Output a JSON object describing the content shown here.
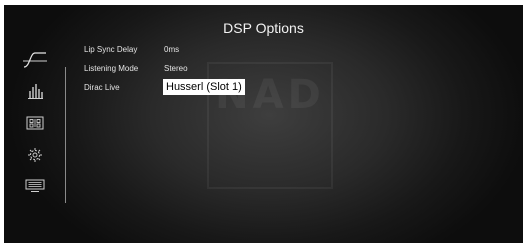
{
  "header": {
    "title": "DSP Options"
  },
  "watermark": {
    "text": "NAD"
  },
  "sidebar": {
    "items": [
      {
        "icon": "wave-icon"
      },
      {
        "icon": "equalizer-icon"
      },
      {
        "icon": "speaker-grid-icon"
      },
      {
        "icon": "gear-icon"
      },
      {
        "icon": "display-icon"
      }
    ]
  },
  "settings": [
    {
      "label": "Lip Sync Delay",
      "value": "0ms"
    },
    {
      "label": "Listening Mode",
      "value": "Stereo"
    },
    {
      "label": "Dirac Live",
      "value": "Husserl (Slot 1)",
      "selected": true
    }
  ],
  "colors": {
    "background": "#2a2a2a",
    "text": "#e4e4e4",
    "highlight": "#ffffff"
  }
}
